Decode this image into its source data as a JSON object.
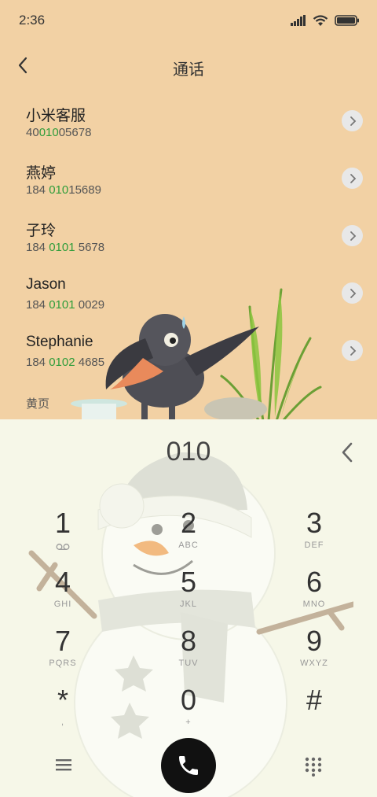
{
  "status_bar": {
    "time": "2:36"
  },
  "header": {
    "title": "通话"
  },
  "contacts": [
    {
      "name": "小米客服",
      "num_pre": "40",
      "num_hl": "010",
      "num_post": "05678"
    },
    {
      "name": "燕婷",
      "num_pre": "184 ",
      "num_hl": "010",
      "num_post": "15689"
    },
    {
      "name": "子玲",
      "num_pre": "184 ",
      "num_hl": "0101",
      "num_post": " 5678"
    },
    {
      "name": "Jason",
      "num_pre": "184 ",
      "num_hl": "0101",
      "num_post": " 0029"
    },
    {
      "name": "Stephanie",
      "num_pre": "184 ",
      "num_hl": "0102",
      "num_post": " 4685"
    }
  ],
  "yellow_pages": "黄页",
  "dialer": {
    "input": "010",
    "keys": [
      {
        "digit": "1",
        "letters": ""
      },
      {
        "digit": "2",
        "letters": "ABC"
      },
      {
        "digit": "3",
        "letters": "DEF"
      },
      {
        "digit": "4",
        "letters": "GHI"
      },
      {
        "digit": "5",
        "letters": "JKL"
      },
      {
        "digit": "6",
        "letters": "MNO"
      },
      {
        "digit": "7",
        "letters": "PQRS"
      },
      {
        "digit": "8",
        "letters": "TUV"
      },
      {
        "digit": "9",
        "letters": "WXYZ"
      },
      {
        "digit": "*",
        "letters": ","
      },
      {
        "digit": "0",
        "letters": "+"
      },
      {
        "digit": "#",
        "letters": ""
      }
    ]
  },
  "icons": {
    "back": "chevron-left-icon",
    "delete": "backspace-chevron-icon",
    "menu": "menu-icon",
    "call": "phone-icon",
    "keypad": "keypad-icon"
  },
  "colors": {
    "match_highlight": "#2f9d3b",
    "top_bg": "#f2d1a4",
    "pad_bg": "#f6f7e8"
  }
}
